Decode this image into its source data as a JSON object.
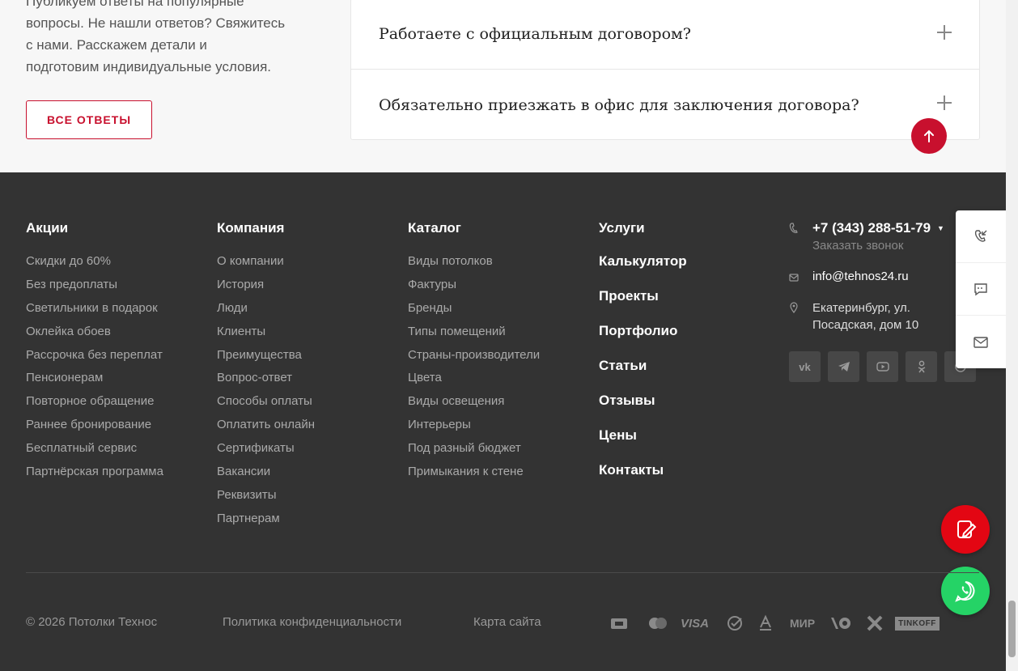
{
  "intro": {
    "line1": "Публикуем ответы на популярные",
    "line2": "вопросы. Не нашли ответов? Свяжитесь",
    "line3": "с нами. Расскажем детали и",
    "line4": "подготовим индивидуальные условия."
  },
  "all_answers_label": "ВСЕ ОТВЕТЫ",
  "faq": [
    {
      "question": "Работаете с официальным договором?"
    },
    {
      "question": "Обязательно приезжать в офис для заключения договора?"
    }
  ],
  "footer": {
    "promo": {
      "title": "Акции",
      "items": [
        "Скидки до 60%",
        "Без предоплаты",
        "Светильники в подарок",
        "Оклейка обоев",
        "Рассрочка без переплат",
        "Пенсионерам",
        "Повторное обращение",
        "Раннее бронирование",
        "Бесплатный сервис",
        "Партнёрская программа"
      ]
    },
    "company": {
      "title": "Компания",
      "items": [
        "О компании",
        "История",
        "Люди",
        "Клиенты",
        "Преимущества",
        "Вопрос-ответ",
        "Способы оплаты",
        "Оплатить онлайн",
        "Сертификаты",
        "Вакансии",
        "Реквизиты",
        "Партнерам"
      ]
    },
    "catalog": {
      "title": "Каталог",
      "items": [
        "Виды потолков",
        "Фактуры",
        "Бренды",
        "Типы помещений",
        "Страны-производители",
        "Цвета",
        "Виды освещения",
        "Интерьеры",
        "Под разный бюджет",
        "Примыкания к стене"
      ]
    },
    "services": {
      "title": "Услуги",
      "items": [
        "Калькулятор",
        "Проекты",
        "Портфолио",
        "Статьи",
        "Отзывы",
        "Цены",
        "Контакты"
      ]
    },
    "contacts": {
      "phone": "+7 (343) 288-51-79",
      "callback": "Заказать звонок",
      "email": "info@tehnos24.ru",
      "address_line1": "Екатеринбург, ул.",
      "address_line2": "Посадская, дом 10"
    },
    "socials": [
      "vk-icon",
      "telegram-icon",
      "youtube-icon",
      "odnoklassniki-icon",
      "whatsapp-icon"
    ],
    "copyright": "© 2026 Потолки Технос",
    "privacy": "Политика конфиденциальности",
    "sitemap": "Карта сайта",
    "payments": {
      "visa": "VISA",
      "mir": "МИР",
      "tinkoff": "TINKOFF"
    }
  },
  "colors": {
    "accent": "#c8102e",
    "footer_bg": "#333333",
    "whatsapp": "#25d366"
  }
}
